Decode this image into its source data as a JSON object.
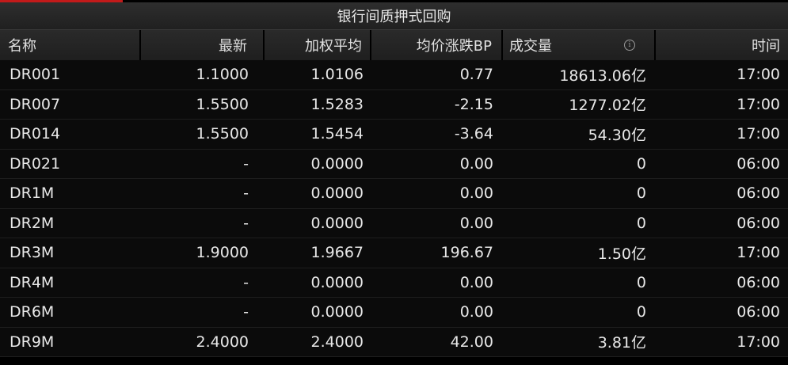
{
  "title": "银行间质押式回购",
  "colors": {
    "up": "#e8313a",
    "down": "#22b34a",
    "flat": "#e8e8e8"
  },
  "headers": {
    "name": "名称",
    "latest": "最新",
    "wavg": "加权平均",
    "bp": "均价涨跌BP",
    "volume": "成交量",
    "time": "时间"
  },
  "rows": [
    {
      "name": "DR001",
      "latest": "1.1000",
      "latest_dir": "up",
      "wavg": "1.0106",
      "wavg_dir": "up",
      "bp": "0.77",
      "bp_dir": "up",
      "volume": "18613.06亿",
      "time": "17:00"
    },
    {
      "name": "DR007",
      "latest": "1.5500",
      "latest_dir": "flat",
      "wavg": "1.5283",
      "wavg_dir": "down",
      "bp": "-2.15",
      "bp_dir": "down",
      "volume": "1277.02亿",
      "time": "17:00"
    },
    {
      "name": "DR014",
      "latest": "1.5500",
      "latest_dir": "down",
      "wavg": "1.5454",
      "wavg_dir": "down",
      "bp": "-3.64",
      "bp_dir": "down",
      "volume": "54.30亿",
      "time": "17:00"
    },
    {
      "name": "DR021",
      "latest": "-",
      "latest_dir": "flat",
      "wavg": "0.0000",
      "wavg_dir": "flat",
      "bp": "0.00",
      "bp_dir": "flat",
      "volume": "0",
      "time": "06:00"
    },
    {
      "name": "DR1M",
      "latest": "-",
      "latest_dir": "flat",
      "wavg": "0.0000",
      "wavg_dir": "flat",
      "bp": "0.00",
      "bp_dir": "flat",
      "volume": "0",
      "time": "06:00"
    },
    {
      "name": "DR2M",
      "latest": "-",
      "latest_dir": "flat",
      "wavg": "0.0000",
      "wavg_dir": "flat",
      "bp": "0.00",
      "bp_dir": "flat",
      "volume": "0",
      "time": "06:00"
    },
    {
      "name": "DR3M",
      "latest": "1.9000",
      "latest_dir": "flat",
      "wavg": "1.9667",
      "wavg_dir": "up",
      "bp": "196.67",
      "bp_dir": "up",
      "volume": "1.50亿",
      "time": "17:00"
    },
    {
      "name": "DR4M",
      "latest": "-",
      "latest_dir": "flat",
      "wavg": "0.0000",
      "wavg_dir": "flat",
      "bp": "0.00",
      "bp_dir": "flat",
      "volume": "0",
      "time": "06:00"
    },
    {
      "name": "DR6M",
      "latest": "-",
      "latest_dir": "flat",
      "wavg": "0.0000",
      "wavg_dir": "flat",
      "bp": "0.00",
      "bp_dir": "flat",
      "volume": "0",
      "time": "06:00"
    },
    {
      "name": "DR9M",
      "latest": "2.4000",
      "latest_dir": "up",
      "wavg": "2.4000",
      "wavg_dir": "up",
      "bp": "42.00",
      "bp_dir": "up",
      "volume": "3.81亿",
      "time": "17:00"
    }
  ]
}
